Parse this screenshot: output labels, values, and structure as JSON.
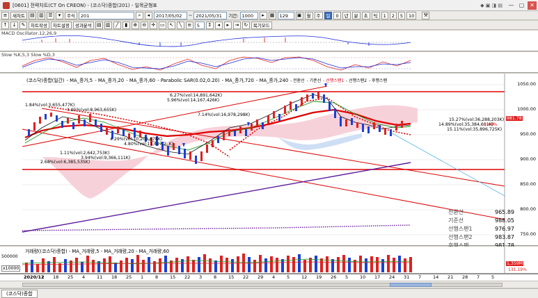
{
  "window": {
    "title": "[0601] 전략차트(CT On CREON) - (코스닥)종합(201) - 일목균형표"
  },
  "toolbar1": {
    "new_chart": "새차트",
    "market_type": "주식",
    "code": "201",
    "start_date": "2017/05/02",
    "end_date": "2021/05/31",
    "period_label": "기간:",
    "period_value": "1000",
    "count_value": "129",
    "periods": [
      "월",
      "주",
      "일",
      "0",
      "년",
      "분",
      "초",
      "틱"
    ],
    "active_period": "일",
    "multipliers": [
      "1",
      "2",
      "5",
      "10"
    ]
  },
  "toolbar2": {
    "arrange": "차트작성",
    "settings": "차트설정",
    "analysis": "성과분석",
    "count": "5",
    "restore_mode": "복기모드"
  },
  "macd_pane": {
    "label": "MACD Oscillator,12,26,9"
  },
  "slow_pane": {
    "label": "Slow %K,5,3  Slow %D,3"
  },
  "price_pane": {
    "legend": [
      {
        "text": "(코스닥)종합(일간)",
        "color": "#000000"
      },
      {
        "text": " - MA_종가,5",
        "color": "#000000"
      },
      {
        "text": " - MA_종가,20",
        "color": "#000000"
      },
      {
        "text": " - MA_종가,60",
        "color": "#000000"
      },
      {
        "text": " - Parabolic SAR(0.02,0.20)",
        "color": "#000000"
      },
      {
        "text": " - MA_종가,720",
        "color": "#000000"
      },
      {
        "text": " - MA_종가,240",
        "color": "#000000"
      },
      {
        "text": " - 전환선",
        "color": "#000000"
      },
      {
        "text": " - 기준선",
        "color": "#000000"
      },
      {
        "text": " - 선행스팬1",
        "color": "#d0021b"
      },
      {
        "text": " - 선행스팬2",
        "color": "#000000"
      },
      {
        "text": " - 후행스팬",
        "color": "#000000"
      }
    ],
    "y_ticks": [
      "1050.00",
      "1000.00",
      "950.00",
      "900.00",
      "850.00",
      "800.00",
      "750.00"
    ],
    "annotations": [
      "6.27%(vol:14,891,642K)",
      "5.96%(vol:14,167,426K)",
      "1.84%(vol:3,655,477K)",
      "3.95%(vol:8,963,655K)",
      "7.14%(vol:16,978,298K)",
      "15.27%(vol:36,288,203K)",
      "14.89%(vol:35,384,651K)",
      "15.11%(vol:35,896,725K)",
      "4.29%(vol:10,203,678K)",
      "4.80%(vol:11,417,2..K)",
      "1.11%(vol:2,642,753K)",
      "3.94%(vol:9,366,111K)",
      "2.68%(vol:6,385,535K)",
      "0.44%"
    ],
    "price_tag": "981.78",
    "ichimoku": [
      {
        "label": "전환선",
        "value": "965.89"
      },
      {
        "label": "기준선",
        "value": "988.05"
      },
      {
        "label": "선행스팬1",
        "value": "976.97"
      },
      {
        "label": "선행스팬2",
        "value": "983.87"
      },
      {
        "label": "후행스팬",
        "value": "981.78"
      }
    ]
  },
  "volume_pane": {
    "legend": [
      {
        "text": "거래량((코스닥)종합)"
      },
      {
        "text": " - MA_거래량,5"
      },
      {
        "text": " - MA_거래량,20"
      },
      {
        "text": " - MA_거래량,60"
      }
    ],
    "y_ticks": [
      "500000",
      "x10000"
    ],
    "last_tag": "1,359M",
    "last_pct": "131.19%"
  },
  "date_axis": {
    "labels": [
      "2020/12",
      "11",
      "18",
      "25",
      "4",
      "11",
      "18",
      "25",
      "1",
      "8",
      "15",
      "22",
      "3",
      "8",
      "15",
      "22",
      "29",
      "4",
      "5",
      "12",
      "19",
      "26",
      "5",
      "10",
      "17",
      "24",
      "31",
      "7",
      "14",
      "21",
      "28",
      "7",
      "5"
    ]
  },
  "status": {
    "tab": "(코스닥)종합"
  },
  "colors": {
    "up": "#e02020",
    "down": "#1a3fd8",
    "cloud": "#f6c9d2",
    "cloud_blue": "#c9dbf4",
    "resistance": "#e00000",
    "trend": "#5a1a9a"
  }
}
